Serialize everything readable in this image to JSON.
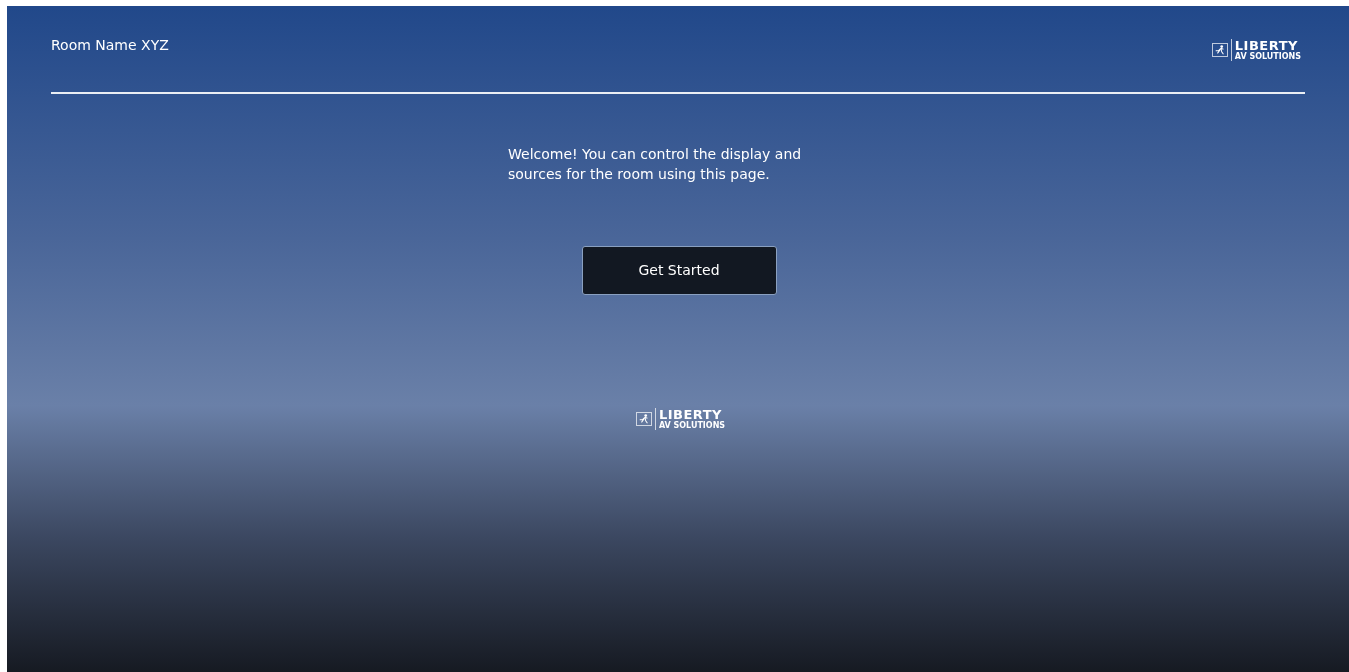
{
  "header": {
    "room_name": "Room Name XYZ",
    "logo": {
      "name": "LIBERTY",
      "tagline": "AV SOLUTIONS"
    }
  },
  "welcome": {
    "message": "Welcome! You can control the display and sources for the room using this page.",
    "button": "Get Started"
  },
  "footer_logo": {
    "name": "LIBERTY",
    "tagline": "AV SOLUTIONS"
  }
}
